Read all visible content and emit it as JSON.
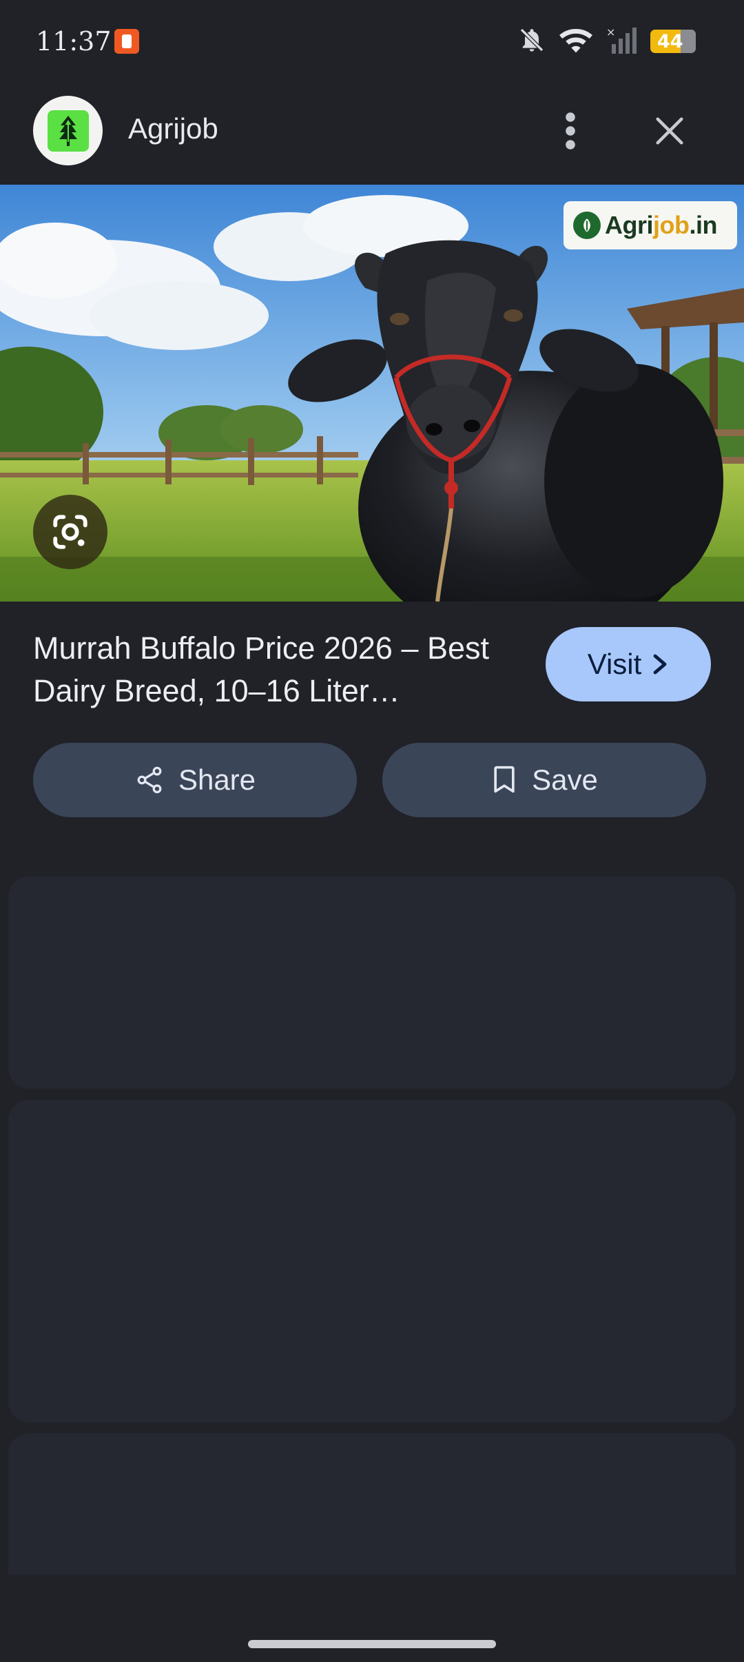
{
  "status_bar": {
    "time": "11:37",
    "app_icon": "notification-app-icon",
    "icons": [
      "bell-off-icon",
      "wifi-icon",
      "signal-icon"
    ],
    "battery": "44"
  },
  "header": {
    "site_name": "Agrijob",
    "avatar_icon": "tree-icon",
    "menu_icon": "more-vert-icon",
    "close_icon": "close-icon"
  },
  "hero": {
    "watermark_prefix": "Agri",
    "watermark_middle": "job",
    "watermark_suffix": ".in",
    "lens_icon": "google-lens-icon"
  },
  "result": {
    "title": "Murrah Buffalo Price 2026 – Best Dairy Breed, 10–16 Liter…",
    "visit_label": "Visit"
  },
  "actions": {
    "share_label": "Share",
    "save_label": "Save"
  },
  "colors": {
    "background": "#202228",
    "visit_button": "#a8c7fa",
    "action_button": "#3a4558",
    "card": "#262831",
    "battery": "#f2b90f"
  }
}
